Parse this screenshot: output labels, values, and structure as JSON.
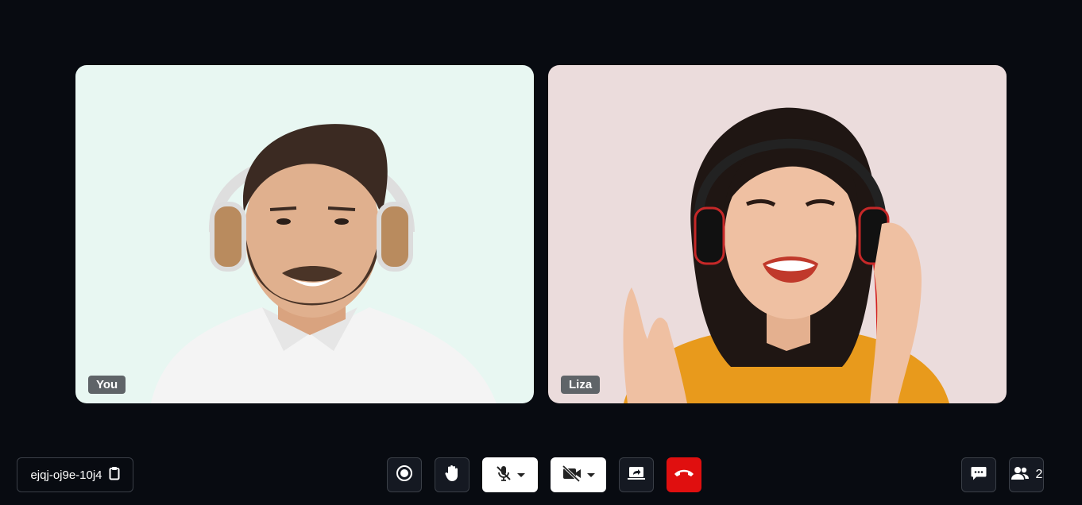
{
  "participants": [
    {
      "name": "You",
      "background": "#e8f7f2"
    },
    {
      "name": "Liza",
      "background": "#ebdcdc"
    }
  ],
  "meeting": {
    "id": "ejqj-oj9e-10j4",
    "copy_icon": "clipboard-icon"
  },
  "controls": {
    "record_icon": "record-icon",
    "raise_hand_icon": "hand-icon",
    "mic_icon": "mic-off-icon",
    "camera_icon": "camera-off-icon",
    "share_icon": "screen-share-icon",
    "leave_icon": "end-call-icon",
    "chat_icon": "chat-icon",
    "people_icon": "people-icon",
    "participant_count": "2"
  },
  "colors": {
    "background": "#080b11",
    "leave": "#e00f0f",
    "tag": "#5f6468"
  }
}
